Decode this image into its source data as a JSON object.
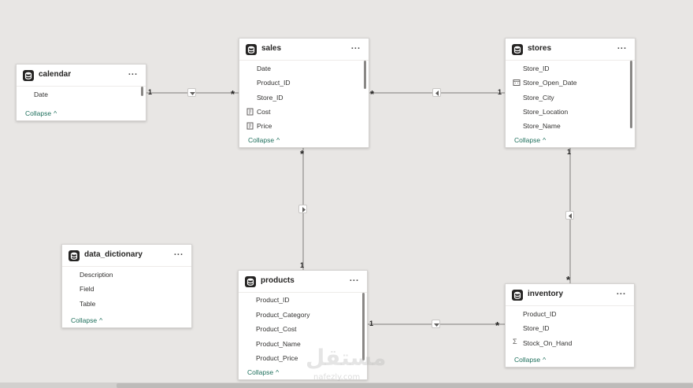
{
  "tables": {
    "calendar": {
      "title": "calendar",
      "more": "...",
      "fields": [
        "Date"
      ],
      "collapse": "Collapse"
    },
    "sales": {
      "title": "sales",
      "more": "...",
      "fields": [
        "Date",
        "Product_ID",
        "Store_ID",
        "Cost",
        "Price"
      ],
      "collapse": "Collapse"
    },
    "stores": {
      "title": "stores",
      "more": "...",
      "fields": [
        "Store_ID",
        "Store_Open_Date",
        "Store_City",
        "Store_Location",
        "Store_Name"
      ],
      "collapse": "Collapse"
    },
    "data_dictionary": {
      "title": "data_dictionary",
      "more": "...",
      "fields": [
        "Description",
        "Field",
        "Table"
      ],
      "collapse": "Collapse"
    },
    "products": {
      "title": "products",
      "more": "...",
      "fields": [
        "Product_ID",
        "Product_Category",
        "Product_Cost",
        "Product_Name",
        "Product_Price"
      ],
      "collapse": "Collapse"
    },
    "inventory": {
      "title": "inventory",
      "more": "...",
      "fields": [
        "Product_ID",
        "Store_ID",
        "Stock_On_Hand"
      ],
      "collapse": "Collapse"
    }
  },
  "relationships": {
    "calendar_sales": {
      "one": "1",
      "many": "*"
    },
    "sales_stores": {
      "one": "1",
      "many": "*"
    },
    "sales_products": {
      "one": "1",
      "many": "*"
    },
    "stores_inventory": {
      "one": "1",
      "many": "*"
    },
    "products_inventory": {
      "one": "1",
      "many": "*"
    }
  },
  "watermark": {
    "main": "مستقل",
    "sub": "nafezly.com"
  },
  "colors": {
    "canvas": "#e8e6e4",
    "link": "#1e6f5c",
    "line": "#a19f9d"
  }
}
